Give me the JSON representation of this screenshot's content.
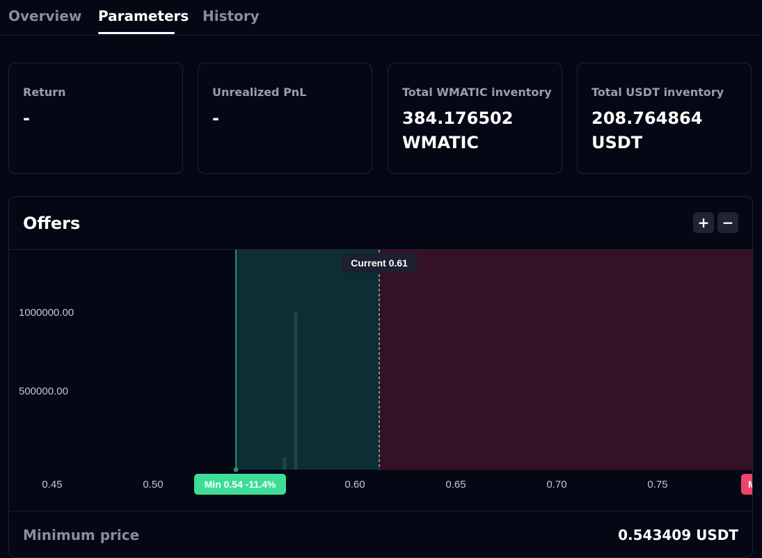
{
  "tabs": [
    {
      "label": "Overview",
      "active": false
    },
    {
      "label": "Parameters",
      "active": true
    },
    {
      "label": "History",
      "active": false
    }
  ],
  "cards": [
    {
      "label": "Return",
      "value": "-"
    },
    {
      "label": "Unrealized PnL",
      "value": "-"
    },
    {
      "label": "Total WMATIC inventory",
      "value": "384.176502 WMATIC"
    },
    {
      "label": "Total USDT inventory",
      "value": "208.764864 USDT"
    }
  ],
  "offers": {
    "title": "Offers",
    "zoom_in": "+",
    "zoom_out": "−",
    "min_price_label": "Minimum price",
    "min_price_value": "0.543409 USDT"
  },
  "colors": {
    "buy_zone": "#0d2e32",
    "sell_zone": "#331226",
    "min_line": "#3ddc97",
    "min_badge": "#3ddc97",
    "max_badge": "#f0456b",
    "bars": "#1d4545"
  },
  "chart_data": {
    "type": "bar",
    "x_ticks": [
      "0.45",
      "0.50",
      "0.60",
      "0.65",
      "0.70",
      "0.75"
    ],
    "y_ticks": [
      "1000000.00",
      "500000.00"
    ],
    "xlim": [
      0.45,
      0.8
    ],
    "ylim": [
      0,
      1400000
    ],
    "current_label": "Current 0.61",
    "current_price": 0.61,
    "min_label": "Min 0.54 -11.4%",
    "min_price": 0.54,
    "max_label": "M",
    "bars": [
      {
        "x": 0.565,
        "y": 80000
      },
      {
        "x": 0.5705,
        "y": 1000000
      }
    ]
  }
}
